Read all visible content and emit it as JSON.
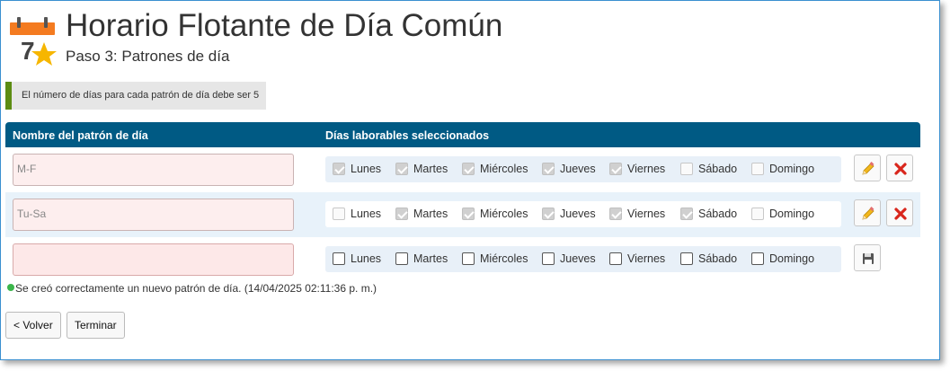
{
  "header": {
    "title": "Horario Flotante de Día Común",
    "subtitle": "Paso 3: Patrones de día",
    "logo_number": "7"
  },
  "info": {
    "text": "El número de días para cada patrón de día debe ser 5"
  },
  "table": {
    "columns": [
      "Nombre del patrón de día",
      "Días laborables seleccionados"
    ],
    "day_labels": [
      "Lunes",
      "Martes",
      "Miércoles",
      "Jueves",
      "Viernes",
      "Sábado",
      "Domingo"
    ],
    "rows": [
      {
        "name": "M-F",
        "days": [
          true,
          true,
          true,
          true,
          true,
          false,
          false
        ],
        "mode": "saved"
      },
      {
        "name": "Tu-Sa",
        "days": [
          false,
          true,
          true,
          true,
          true,
          true,
          false
        ],
        "mode": "saved"
      },
      {
        "name": "",
        "days": [
          false,
          false,
          false,
          false,
          false,
          false,
          false
        ],
        "mode": "new"
      }
    ]
  },
  "message": {
    "text": "Se creó correctamente un nuevo patrón de día. (14/04/2025 02:11:36 p. m.)"
  },
  "footer": {
    "back_label": "< Volver",
    "finish_label": "Terminar"
  },
  "colors": {
    "header_bg": "#005a84",
    "accent_green": "#5c8c12",
    "delete_red": "#d9261c"
  }
}
